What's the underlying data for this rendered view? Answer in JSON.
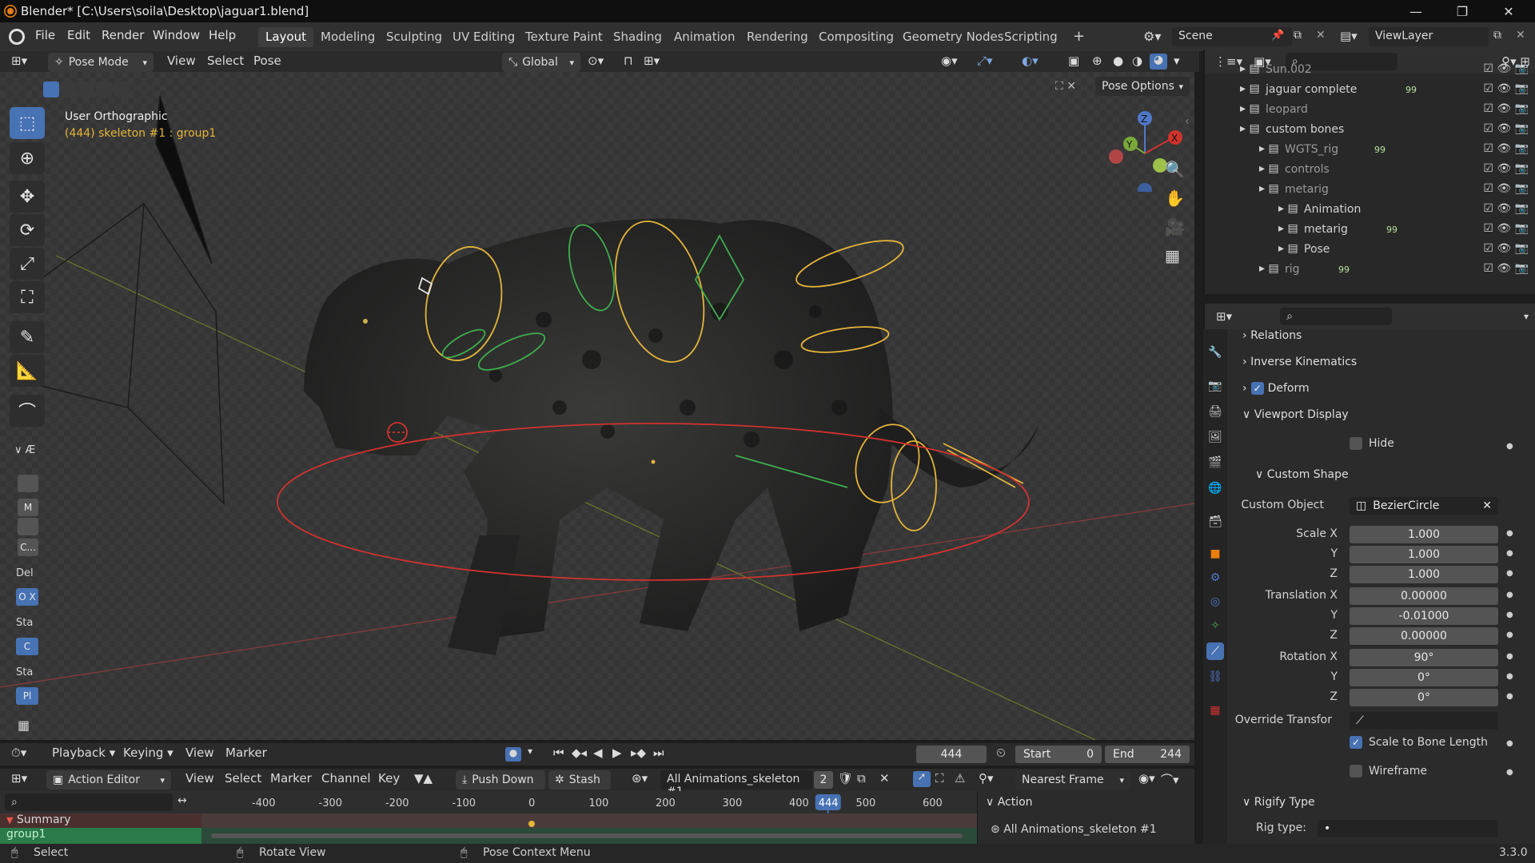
{
  "window": {
    "title": "Blender* [C:\\Users\\soila\\Desktop\\jaguar1.blend]",
    "minimize": "—",
    "maximize": "❐",
    "close": "✕"
  },
  "menubar": {
    "items": [
      "File",
      "Edit",
      "Render",
      "Window",
      "Help"
    ],
    "workspaces": [
      "Layout",
      "Modeling",
      "Sculpting",
      "UV Editing",
      "Texture Paint",
      "Shading",
      "Animation",
      "Rendering",
      "Compositing",
      "Geometry Nodes",
      "Scripting"
    ],
    "active_workspace": "Layout",
    "add_tab": "+",
    "scene": "Scene",
    "view_layer": "ViewLayer"
  },
  "viewport_header": {
    "mode": "Pose Mode",
    "menus": [
      "View",
      "Select",
      "Pose"
    ],
    "orientation": "Global",
    "pose_options": "Pose Options"
  },
  "viewport": {
    "view_name": "User Orthographic",
    "info": "(444) skeleton #1 : group1",
    "gizmo_axes": [
      "Z",
      "Y",
      "X"
    ],
    "side_panel": {
      "collapse_label": "Æ",
      "buttons": [
        "M",
        "C...",
        "Del",
        "O X",
        "Sta",
        "C",
        "Sta",
        "Pl"
      ]
    }
  },
  "outliner": {
    "rows": [
      {
        "name": "Sun.002",
        "indent": 1,
        "dim": true
      },
      {
        "name": "jaguar complete",
        "indent": 1,
        "badge": "99"
      },
      {
        "name": "leopard",
        "indent": 1,
        "dim": true
      },
      {
        "name": "custom bones",
        "indent": 1
      },
      {
        "name": "WGTS_rig",
        "indent": 2,
        "dim": true,
        "badge": "99"
      },
      {
        "name": "controls",
        "indent": 2,
        "dim": true
      },
      {
        "name": "metarig",
        "indent": 2,
        "dim": true
      },
      {
        "name": "Animation",
        "indent": 3
      },
      {
        "name": "metarig",
        "indent": 3,
        "badge": "99"
      },
      {
        "name": "Pose",
        "indent": 3
      },
      {
        "name": "rig",
        "indent": 2,
        "dim": true,
        "badge": "99"
      }
    ]
  },
  "properties": {
    "sections": {
      "relations": "Relations",
      "ik": "Inverse Kinematics",
      "deform": "Deform",
      "viewport_display": "Viewport Display",
      "hide": "Hide",
      "custom_shape": "Custom Shape",
      "rigify_type": "Rigify Type"
    },
    "custom_object_label": "Custom Object",
    "custom_object_value": "BezierCircle",
    "scale_label": "Scale X",
    "scale": [
      "1.000",
      "1.000",
      "1.000"
    ],
    "translation_label": "Translation X",
    "translation": [
      "0.00000",
      "-0.01000",
      "0.00000"
    ],
    "rotation_label": "Rotation X",
    "rotation": [
      "90°",
      "0°",
      "0°"
    ],
    "axis_y": "Y",
    "axis_z": "Z",
    "override_label": "Override Transfor",
    "scale_to_bone": "Scale to Bone Length",
    "wireframe": "Wireframe",
    "rig_type_label": "Rig type:"
  },
  "timeline": {
    "menus": [
      "Playback",
      "Keying",
      "View",
      "Marker"
    ],
    "current_frame": "444",
    "start_label": "Start",
    "start": "0",
    "end_label": "End",
    "end": "244"
  },
  "action_editor": {
    "mode": "Action Editor",
    "menus": [
      "View",
      "Select",
      "Marker",
      "Channel",
      "Key"
    ],
    "push_down": "Push Down",
    "stash": "Stash",
    "action_name": "All Animations_skeleton #1",
    "users": "2",
    "snap": "Nearest Frame",
    "ruler": [
      "-400",
      "-300",
      "-200",
      "-100",
      "0",
      "100",
      "200",
      "300",
      "400",
      "500",
      "600"
    ],
    "playhead": "444",
    "summary": "Summary",
    "group": "group1",
    "side_panel_title": "Action",
    "side_panel_action": "All Animations_skeleton #1"
  },
  "statusbar": {
    "select": "Select",
    "rotate": "Rotate View",
    "context": "Pose Context Menu",
    "version": "3.3.0"
  },
  "colors": {
    "accent": "#4772b3",
    "bone_selected": "#e5b53a",
    "bone_green": "#3fae4d",
    "root_red": "#d0322e",
    "frame_blue": "#4772b3"
  }
}
